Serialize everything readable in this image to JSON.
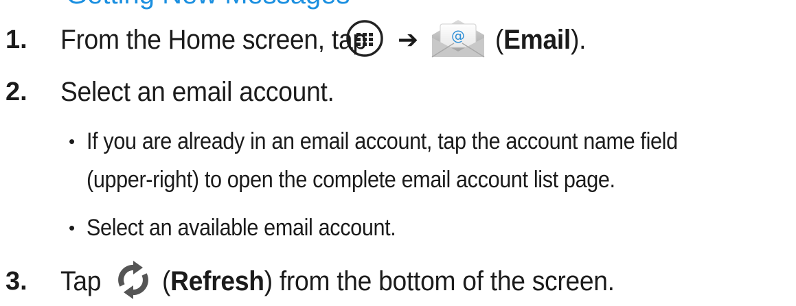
{
  "heading": "Getting New Messages",
  "steps": [
    {
      "number": "1.",
      "before": "From the Home screen, tap",
      "arrow": "➔",
      "paren_open": "(",
      "bold": "Email",
      "paren_close": ").",
      "icons": [
        "apps-icon",
        "email-app-icon"
      ]
    },
    {
      "number": "2.",
      "text": "Select an email account."
    },
    {
      "number": "3.",
      "before": "Tap",
      "paren_open": "(",
      "bold": "Refresh",
      "after": ") from the bottom of the screen.",
      "icon": "refresh-icon"
    }
  ],
  "bullets": [
    {
      "line1": "If you are already in an email account, tap the account name field",
      "line2": "(upper-right) to open the complete email account list page."
    },
    {
      "line1": "Select an available email account."
    }
  ],
  "bullet_char": "•",
  "colors": {
    "heading": "#1a8fe0",
    "text": "#1b1b1b",
    "icon_dark": "#222222",
    "refresh_gray": "#555555"
  }
}
